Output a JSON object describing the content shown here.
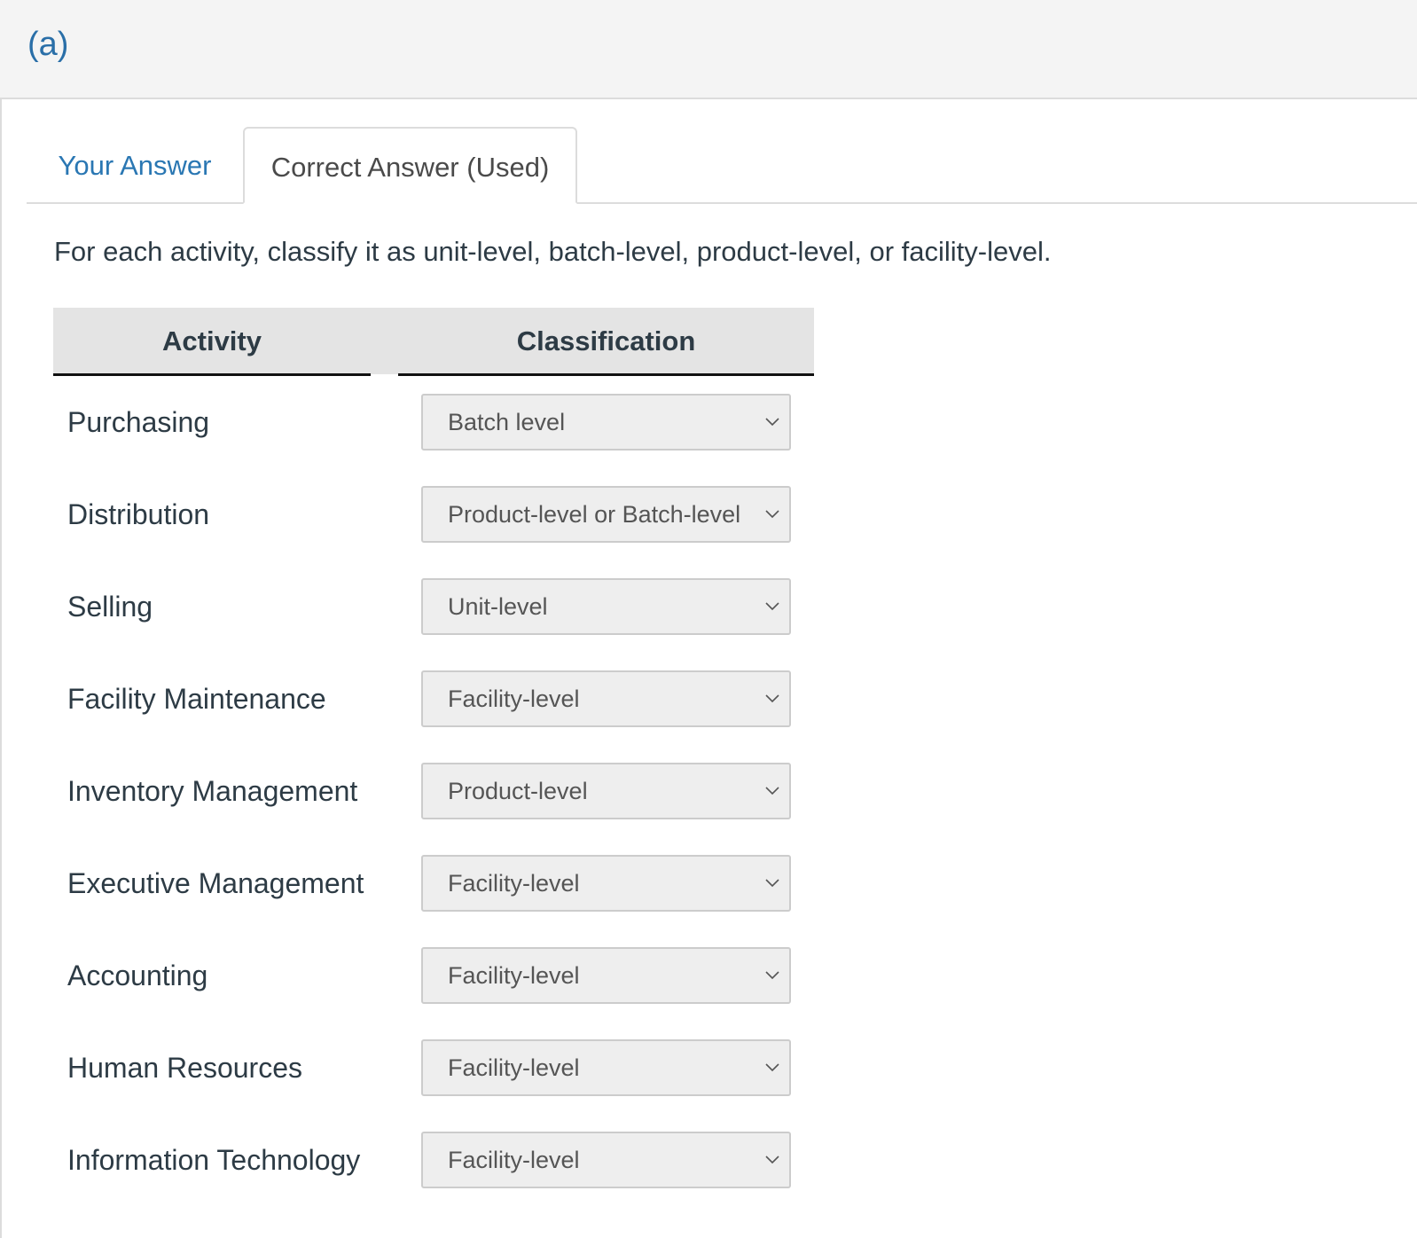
{
  "part": {
    "label": "(a)"
  },
  "tabs": [
    {
      "label": "Your Answer",
      "active": false
    },
    {
      "label": "Correct Answer (Used)",
      "active": true
    }
  ],
  "instructions": "For each activity, classify it as unit-level, batch-level, product-level, or facility-level.",
  "table": {
    "headers": {
      "activity": "Activity",
      "classification": "Classification"
    },
    "rows": [
      {
        "activity": "Purchasing",
        "classification": "Batch level"
      },
      {
        "activity": "Distribution",
        "classification": "Product-level or Batch-level"
      },
      {
        "activity": "Selling",
        "classification": "Unit-level"
      },
      {
        "activity": "Facility Maintenance",
        "classification": "Facility-level"
      },
      {
        "activity": "Inventory Management",
        "classification": "Product-level"
      },
      {
        "activity": "Executive Management",
        "classification": "Facility-level"
      },
      {
        "activity": "Accounting",
        "classification": "Facility-level"
      },
      {
        "activity": "Human Resources",
        "classification": "Facility-level"
      },
      {
        "activity": "Information Technology",
        "classification": "Facility-level"
      }
    ]
  },
  "icons": {
    "select_arrow": "chevron-down-icon"
  },
  "colors": {
    "link_blue": "#2a77b3",
    "header_bg": "#f4f4f4",
    "table_head_bg": "#e4e4e4",
    "select_bg": "#eeeeee"
  }
}
